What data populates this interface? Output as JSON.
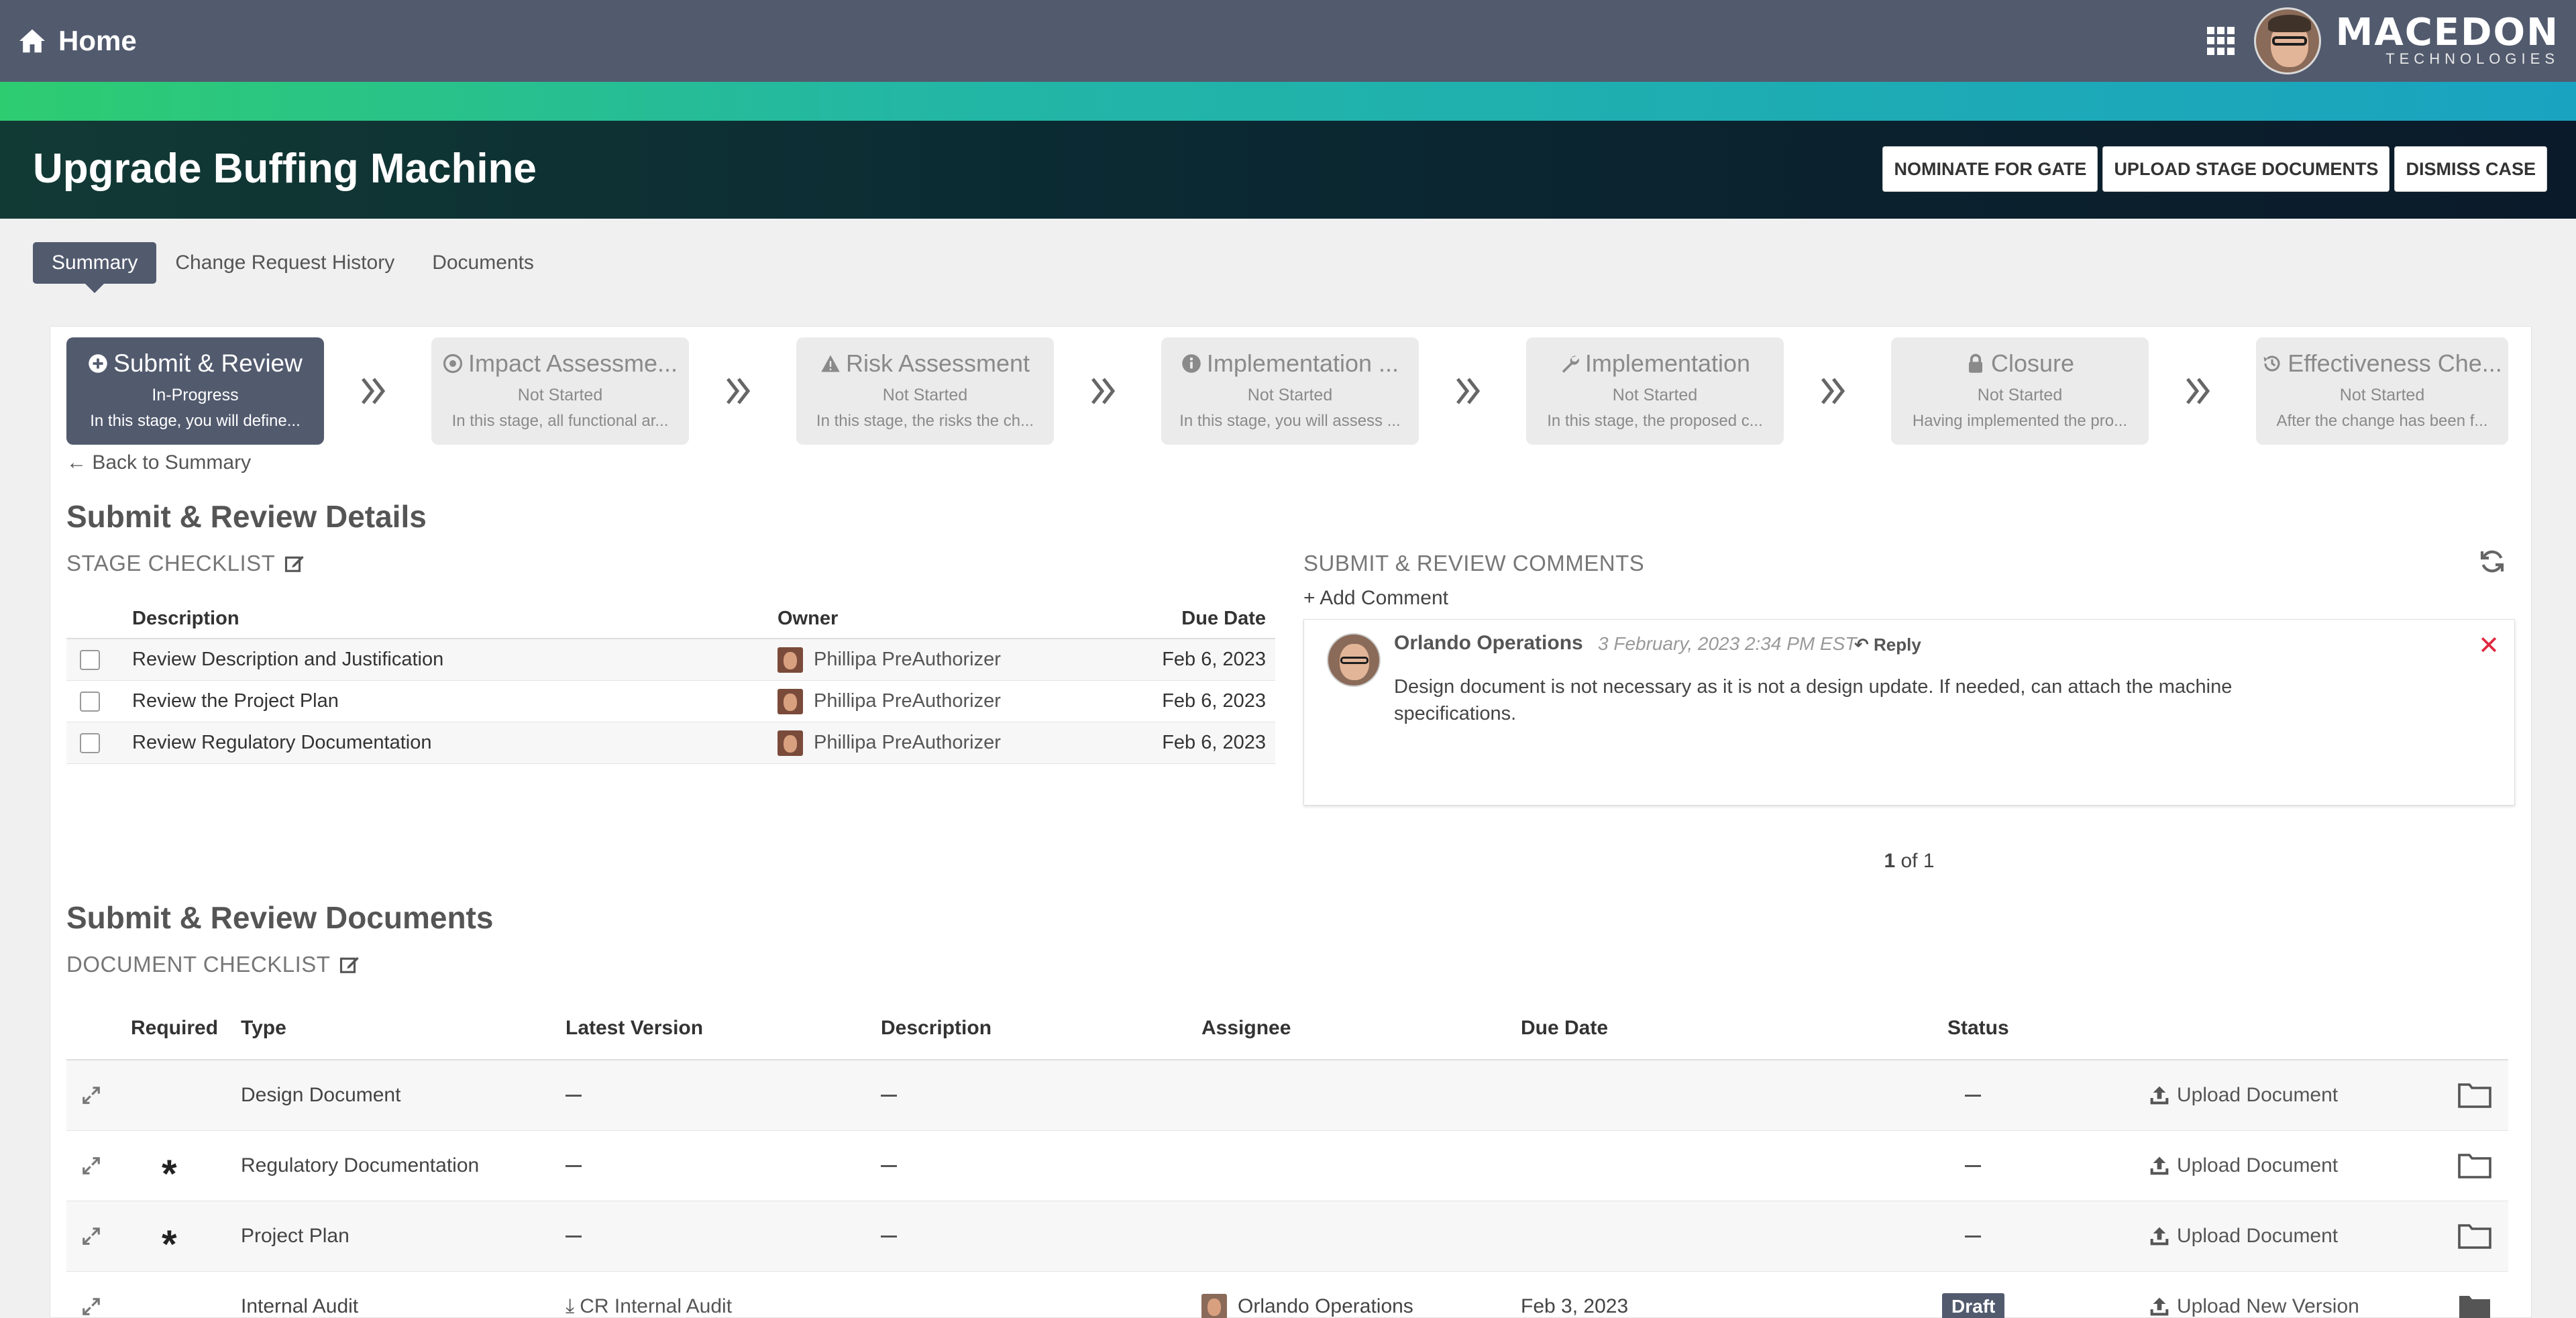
{
  "header": {
    "home_label": "Home",
    "brand_name": "MACEDON",
    "brand_sub": "TECHNOLOGIES"
  },
  "case": {
    "title": "Upgrade Buffing Machine",
    "actions": [
      "NOMINATE FOR GATE",
      "UPLOAD STAGE DOCUMENTS",
      "DISMISS CASE"
    ]
  },
  "tabs": [
    {
      "label": "Summary",
      "active": true
    },
    {
      "label": "Change Request History",
      "active": false
    },
    {
      "label": "Documents",
      "active": false
    }
  ],
  "stages": [
    {
      "icon": "plus-circle-icon",
      "title": "Submit & Review",
      "status": "In-Progress",
      "desc": "In this stage, you will define...",
      "active": true
    },
    {
      "icon": "target-icon",
      "title": "Impact Assessme...",
      "status": "Not Started",
      "desc": "In this stage, all functional ar...",
      "active": false
    },
    {
      "icon": "warning-icon",
      "title": "Risk Assessment",
      "status": "Not Started",
      "desc": "In this stage, the risks the ch...",
      "active": false
    },
    {
      "icon": "info-icon",
      "title": "Implementation ...",
      "status": "Not Started",
      "desc": "In this stage, you will assess ...",
      "active": false
    },
    {
      "icon": "wrench-icon",
      "title": "Implementation",
      "status": "Not Started",
      "desc": "In this stage, the proposed c...",
      "active": false
    },
    {
      "icon": "lock-icon",
      "title": "Closure",
      "status": "Not Started",
      "desc": "Having implemented the pro...",
      "active": false
    },
    {
      "icon": "history-icon",
      "title": "Effectiveness Che...",
      "status": "Not Started",
      "desc": "After the change has been f...",
      "active": false
    }
  ],
  "back_link": "Back to Summary",
  "details": {
    "heading": "Submit & Review Details",
    "checklist_label": "STAGE CHECKLIST",
    "columns": {
      "description": "Description",
      "owner": "Owner",
      "due": "Due Date"
    },
    "rows": [
      {
        "description": "Review Description and Justification",
        "owner": "Phillipa PreAuthorizer",
        "due": "Feb 6, 2023"
      },
      {
        "description": "Review the Project Plan",
        "owner": "Phillipa PreAuthorizer",
        "due": "Feb 6, 2023"
      },
      {
        "description": "Review Regulatory Documentation",
        "owner": "Phillipa PreAuthorizer",
        "due": "Feb 6, 2023"
      }
    ]
  },
  "comments": {
    "heading": "SUBMIT & REVIEW COMMENTS",
    "add_label": "Add Comment",
    "items": [
      {
        "author": "Orlando Operations",
        "date": "3 February, 2023 2:34 PM  EST",
        "reply_label": "Reply",
        "text": "Design document is not necessary as it is not a design update. If needed, can attach the machine specifications."
      }
    ],
    "pager": {
      "current": "1",
      "of": "of 1"
    }
  },
  "documents": {
    "heading": "Submit & Review Documents",
    "checklist_label": "DOCUMENT CHECKLIST",
    "columns": {
      "required": "Required",
      "type": "Type",
      "latest": "Latest Version",
      "description": "Description",
      "assignee": "Assignee",
      "due": "Due Date",
      "status": "Status"
    },
    "rows": [
      {
        "required": false,
        "type": "Design Document",
        "latest": "",
        "description": "",
        "assignee": "",
        "due": "",
        "status": "",
        "action": "Upload Document"
      },
      {
        "required": true,
        "type": "Regulatory Documentation",
        "latest": "",
        "description": "",
        "assignee": "",
        "due": "",
        "status": "",
        "action": "Upload Document"
      },
      {
        "required": true,
        "type": "Project Plan",
        "latest": "",
        "description": "",
        "assignee": "",
        "due": "",
        "status": "",
        "action": "Upload Document"
      },
      {
        "required": false,
        "type": "Internal Audit",
        "latest": "CR Internal Audit",
        "description": "",
        "assignee": "Orlando Operations",
        "due": "Feb 3, 2023",
        "status": "Draft",
        "action": "Upload New Version"
      }
    ]
  },
  "colors": {
    "topbar": "#525a6e",
    "accent_green": "#2ecc71",
    "accent_teal": "#1aa3c0",
    "delete_red": "#e0283f"
  }
}
